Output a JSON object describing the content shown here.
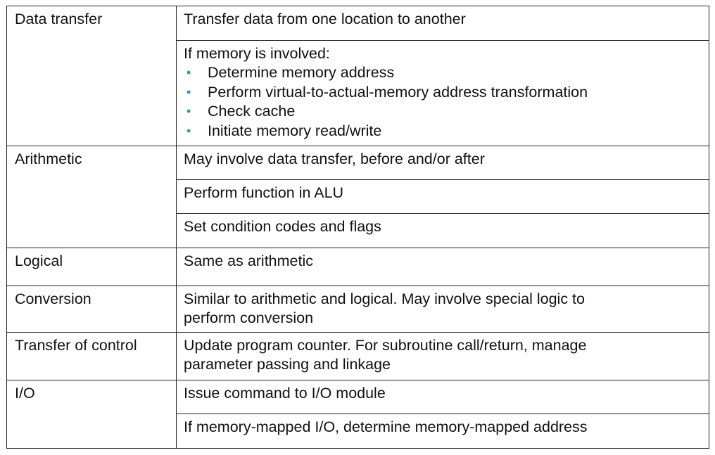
{
  "table": {
    "rows": [
      {
        "category": "Data transfer",
        "actions": [
          {
            "text": "Transfer data from one location to another"
          },
          {
            "text": "If memory is involved:",
            "bullets": [
              "Determine memory address",
              "Perform virtual-to-actual-memory address transformation",
              "Check cache",
              "Initiate memory read/write"
            ]
          }
        ]
      },
      {
        "category": "Arithmetic",
        "actions": [
          {
            "text": "May involve data transfer, before and/or after"
          },
          {
            "text": "Perform function in ALU"
          },
          {
            "text": "Set condition codes and flags"
          }
        ]
      },
      {
        "category": "Logical",
        "actions": [
          {
            "text": "Same as arithmetic"
          }
        ]
      },
      {
        "category": "Conversion",
        "actions": [
          {
            "lines": [
              "Similar to arithmetic and logical. May involve special logic to",
              "perform conversion"
            ]
          }
        ]
      },
      {
        "category": "Transfer of control",
        "actions": [
          {
            "lines": [
              "Update program counter. For subroutine call/return, manage",
              "parameter passing and linkage"
            ]
          }
        ]
      },
      {
        "category": "I/O",
        "actions": [
          {
            "text": "Issue command to I/O module"
          },
          {
            "text": "If memory-mapped I/O, determine memory-mapped address"
          }
        ]
      }
    ],
    "bullet_glyph": "•",
    "bullet_color": "#2a9bb5"
  }
}
